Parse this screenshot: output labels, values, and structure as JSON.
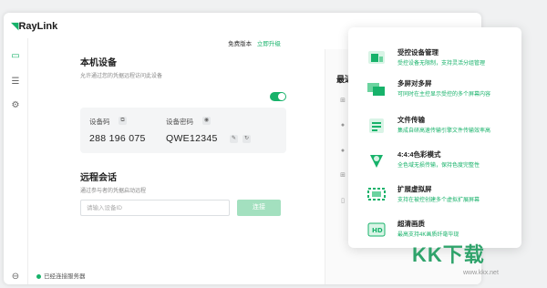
{
  "app": {
    "logo": "RayLink"
  },
  "topbar": {
    "version": "免费版本",
    "upgrade": "立即升级"
  },
  "local": {
    "title": "本机设备",
    "subtitle": "允许通过您的凭据远程访问此设备",
    "code_label": "设备码",
    "code_value": "288 196 075",
    "pwd_label": "设备密码",
    "pwd_value": "QWE12345"
  },
  "session": {
    "title": "远程会话",
    "subtitle": "通过参与者的凭据启动远程",
    "placeholder": "请输入设备ID",
    "connect": "连接"
  },
  "recent": {
    "title": "最近"
  },
  "status": "已经连接服务器",
  "features": [
    {
      "title": "受控设备管理",
      "desc": "受控设备无限制，支持灵活分组管理",
      "icon": "device-manage-icon"
    },
    {
      "title": "多屏对多屏",
      "desc": "可同时在主控显示受控的多个屏幕内容",
      "icon": "multi-screen-icon"
    },
    {
      "title": "文件传输",
      "desc": "集成自研高速传输引擎文件传输效率高",
      "icon": "file-transfer-icon"
    },
    {
      "title": "4:4:4色彩模式",
      "desc": "全色域无损传输，保持色度完整性",
      "icon": "color-mode-icon"
    },
    {
      "title": "扩展虚拟屏",
      "desc": "支持在被控创建多个虚拟扩展屏幕",
      "icon": "virtual-screen-icon"
    },
    {
      "title": "超清画质",
      "desc": "最高支持4K画质纤毫毕现",
      "icon": "hd-icon"
    }
  ],
  "watermark": {
    "text": "KK下载",
    "url": "www.kkx.net"
  },
  "colors": {
    "accent": "#17b26a"
  }
}
